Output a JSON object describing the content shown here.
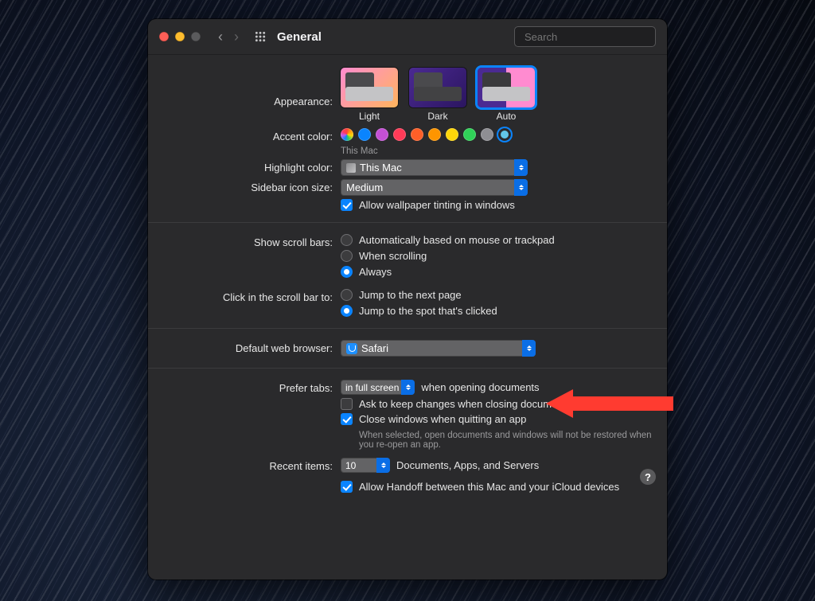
{
  "header": {
    "title": "General",
    "search_placeholder": "Search"
  },
  "appearance": {
    "label": "Appearance:",
    "options": {
      "light": "Light",
      "dark": "Dark",
      "auto": "Auto"
    },
    "selected": "Auto"
  },
  "accent": {
    "label": "Accent color:",
    "note": "This Mac",
    "colors": [
      "multicolor",
      "#0a84ff",
      "#c450d5",
      "#ff3b58",
      "#ff5f28",
      "#ff9500",
      "#ffd60a",
      "#30d158",
      "#8e8e93",
      "#62c7e8"
    ],
    "selected_index": 9
  },
  "highlight": {
    "label": "Highlight color:",
    "value": "This Mac"
  },
  "sidebar_size": {
    "label": "Sidebar icon size:",
    "value": "Medium"
  },
  "wallpaper_tint": {
    "label": "Allow wallpaper tinting in windows",
    "checked": true
  },
  "scrollbars": {
    "label": "Show scroll bars:",
    "options": {
      "auto": "Automatically based on mouse or trackpad",
      "scrolling": "When scrolling",
      "always": "Always"
    },
    "selected": "always"
  },
  "scroll_click": {
    "label": "Click in the scroll bar to:",
    "options": {
      "next": "Jump to the next page",
      "spot": "Jump to the spot that's clicked"
    },
    "selected": "spot"
  },
  "browser": {
    "label": "Default web browser:",
    "value": "Safari"
  },
  "tabs": {
    "prefer_label": "Prefer tabs:",
    "prefer_value": "in full screen",
    "prefer_suffix": "when opening documents",
    "ask_keep_label": "Ask to keep changes when closing documents",
    "ask_keep_checked": false,
    "close_windows_label": "Close windows when quitting an app",
    "close_windows_checked": true,
    "close_windows_note": "When selected, open documents and windows will not be restored when you re-open an app."
  },
  "recent": {
    "label": "Recent items:",
    "value": "10",
    "suffix": "Documents, Apps, and Servers"
  },
  "handoff": {
    "label": "Allow Handoff between this Mac and your iCloud devices",
    "checked": true
  },
  "help_symbol": "?"
}
